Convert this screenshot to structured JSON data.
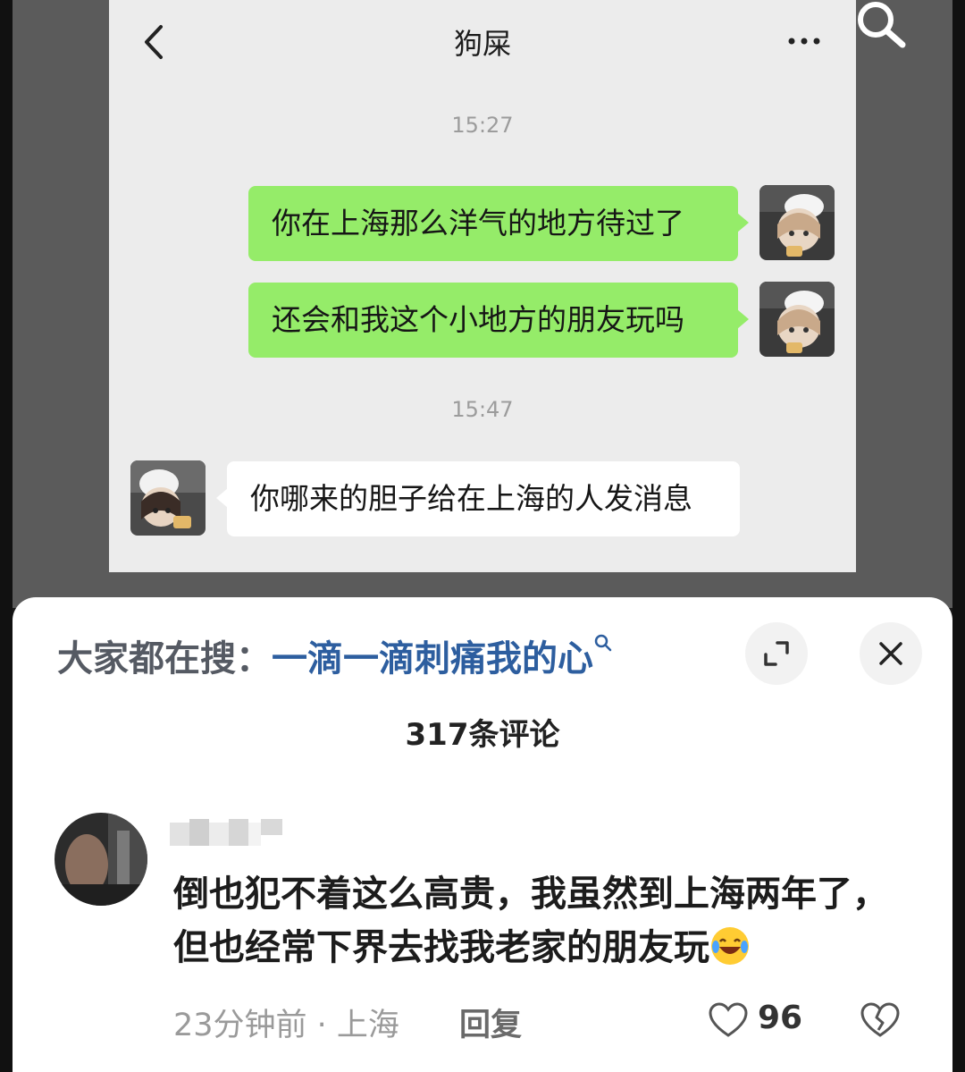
{
  "chat": {
    "title": "狗屎",
    "timestamps": [
      "15:27",
      "15:47"
    ],
    "messages": [
      {
        "side": "right",
        "text": "你在上海那么洋气的地方待过了"
      },
      {
        "side": "right",
        "text": "还会和我这个小地方的朋友玩吗"
      },
      {
        "side": "left",
        "text": "你哪来的胆子给在上海的人发消息"
      }
    ],
    "colors": {
      "sent_bubble": "#95ec69",
      "received_bubble": "#ffffff",
      "background": "#ececec"
    }
  },
  "sheet": {
    "search_prefix": "大家都在搜：",
    "search_term": "一滴一滴刺痛我的心",
    "comment_count": "317条评论",
    "comment": {
      "text_line1": "倒也犯不着这么高贵，我虽然到上海两年了，",
      "text_line2": "但也经常下界去找我老家的朋友玩",
      "time_location": "23分钟前 · 上海",
      "reply_label": "回复",
      "likes": "96"
    },
    "colors": {
      "search_term": "#2d5e9f"
    }
  },
  "icons": [
    "back-icon",
    "more-icon",
    "search-icon",
    "expand-icon",
    "close-icon",
    "laugh-cry-emoji",
    "heart-icon",
    "dislike-icon"
  ]
}
